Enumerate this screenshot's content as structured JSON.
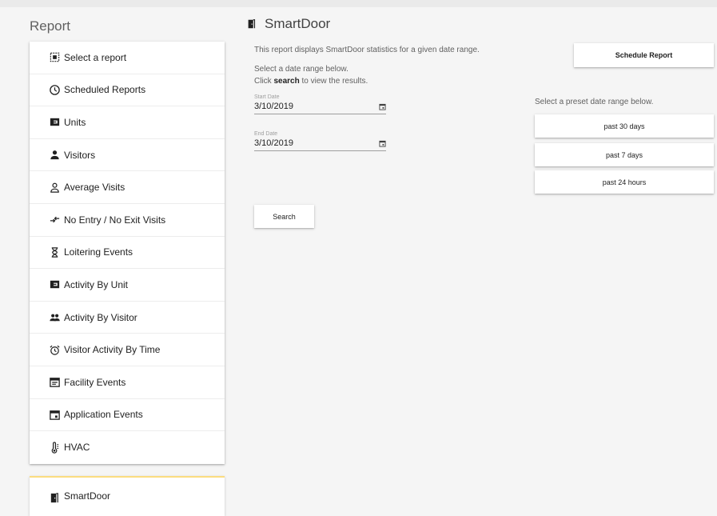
{
  "sidebar": {
    "title": "Report",
    "items": [
      {
        "label": "Select a report",
        "icon": "report-select-icon"
      },
      {
        "label": "Scheduled Reports",
        "icon": "clock-icon"
      },
      {
        "label": "Units",
        "icon": "unit-icon"
      },
      {
        "label": "Visitors",
        "icon": "person-icon"
      },
      {
        "label": "Average Visits",
        "icon": "person-outline-icon"
      },
      {
        "label": "No Entry / No Exit Visits",
        "icon": "swap-arrows-icon"
      },
      {
        "label": "Loitering Events",
        "icon": "hourglass-icon"
      },
      {
        "label": "Activity By Unit",
        "icon": "unit-icon"
      },
      {
        "label": "Activity By Visitor",
        "icon": "people-icon"
      },
      {
        "label": "Visitor Activity By Time",
        "icon": "alarm-clock-icon"
      },
      {
        "label": "Facility Events",
        "icon": "calendar-note-icon"
      },
      {
        "label": "Application Events",
        "icon": "calendar-icon"
      },
      {
        "label": "HVAC",
        "icon": "thermometer-icon"
      }
    ],
    "selected": {
      "label": "SmartDoor",
      "icon": "door-icon",
      "accent": "#fbdc80"
    }
  },
  "main": {
    "title": "SmartDoor",
    "description": "This report displays SmartDoor statistics for a given date range.",
    "hint_line1": "Select a date range below.",
    "hint_click": "Click ",
    "hint_bold": "search",
    "hint_rest": " to view the results.",
    "start_label": "Start Date",
    "start_value": "3/10/2019",
    "end_label": "End Date",
    "end_value": "3/10/2019",
    "search_label": "Search",
    "schedule_label": "Schedule Report",
    "preset_label": "Select a preset date range below.",
    "presets": [
      "past 30 days",
      "past 7 days",
      "past 24 hours"
    ]
  }
}
